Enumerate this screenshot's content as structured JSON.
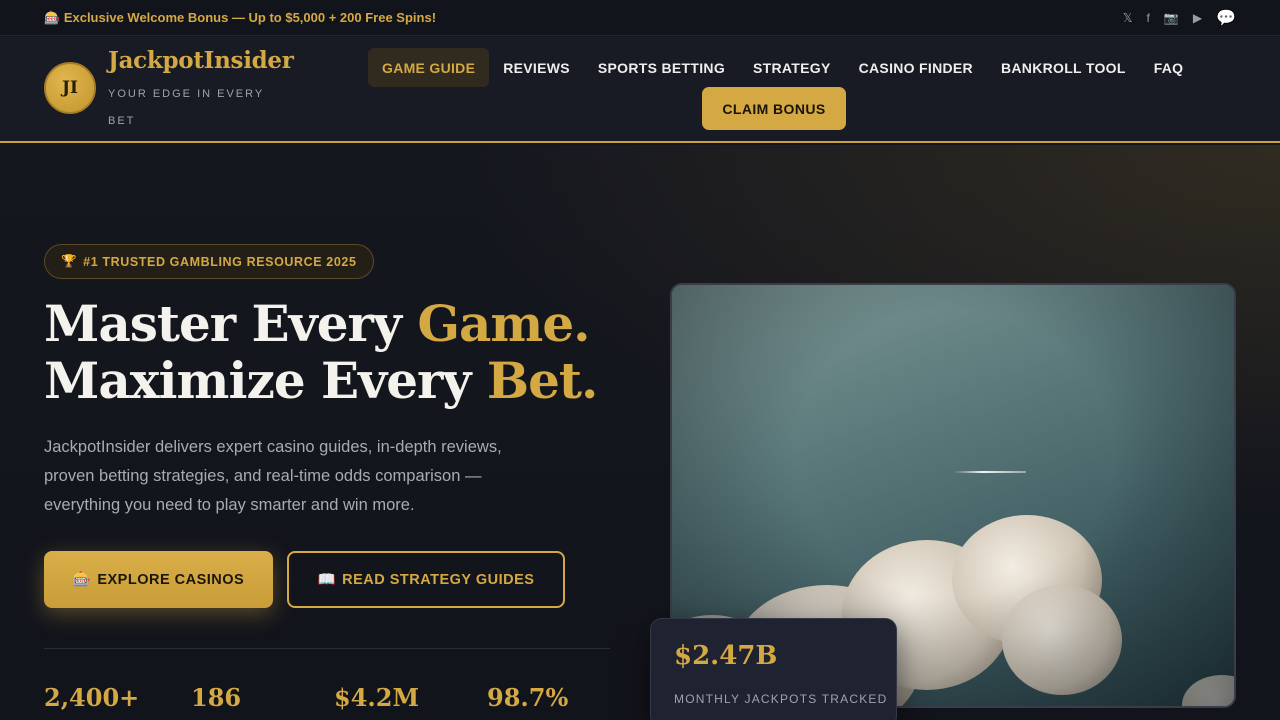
{
  "topbar": {
    "promo_icon": "🎰",
    "promo_text": "Exclusive Welcome Bonus — Up to $5,000 + 200 Free Spins!",
    "social": [
      {
        "name": "x-icon",
        "glyph": "𝕏"
      },
      {
        "name": "facebook-icon",
        "glyph": "f"
      },
      {
        "name": "instagram-icon",
        "glyph": "📷"
      },
      {
        "name": "youtube-icon",
        "glyph": "▶"
      },
      {
        "name": "chat-icon",
        "glyph": "💬"
      }
    ]
  },
  "header": {
    "logo_initials": "JI",
    "brand": "JackpotInsider",
    "tagline": "YOUR EDGE IN EVERY BET",
    "nav": [
      {
        "label": "GAME GUIDE",
        "active": true
      },
      {
        "label": "REVIEWS",
        "active": false
      },
      {
        "label": "SPORTS BETTING",
        "active": false
      },
      {
        "label": "STRATEGY",
        "active": false
      },
      {
        "label": "CASINO FINDER",
        "active": false
      },
      {
        "label": "BANKROLL TOOL",
        "active": false
      },
      {
        "label": "FAQ",
        "active": false
      }
    ],
    "cta_label": "CLAIM BONUS"
  },
  "hero": {
    "badge_icon": "🏆",
    "badge_text": "#1 TRUSTED GAMBLING RESOURCE 2025",
    "headline_line1_a": "Master Every ",
    "headline_line1_b": "Game.",
    "headline_line2_a": "Maximize Every ",
    "headline_line2_b": "Bet.",
    "description": "JackpotInsider delivers expert casino guides, in-depth reviews, proven betting strategies, and real-time odds comparison — everything you need to play smarter and win more.",
    "primary_icon": "🎰",
    "primary_label": "EXPLORE CASINOS",
    "secondary_icon": "📖",
    "secondary_label": "READ STRATEGY GUIDES",
    "stats": [
      "2,400+",
      "186",
      "$4.2M",
      "98.7%"
    ]
  },
  "float_card": {
    "value": "$2.47B",
    "label": "MONTHLY JACKPOTS TRACKED"
  },
  "colors": {
    "accent": "#d4a843",
    "background": "#14161f",
    "header": "#181a24"
  }
}
